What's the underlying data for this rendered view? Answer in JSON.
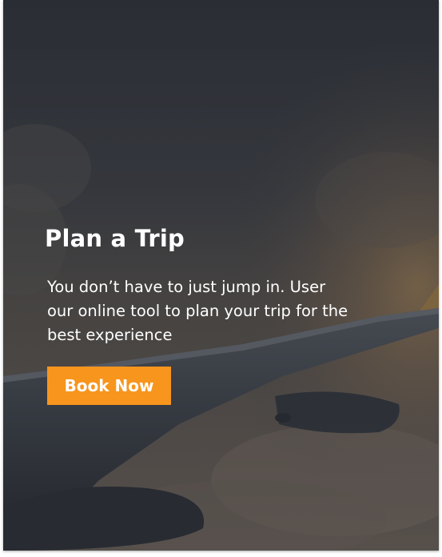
{
  "hero": {
    "title": "Plan a Trip",
    "description": "You don’t have to just jump in. User our online tool to plan your trip for the best experience",
    "button_label": "Book Now"
  },
  "colors": {
    "accent": "#f7951d",
    "overlay": "#2f333b",
    "text": "#ffffff"
  },
  "background_image": "airplane-wing-above-clouds-sunset"
}
